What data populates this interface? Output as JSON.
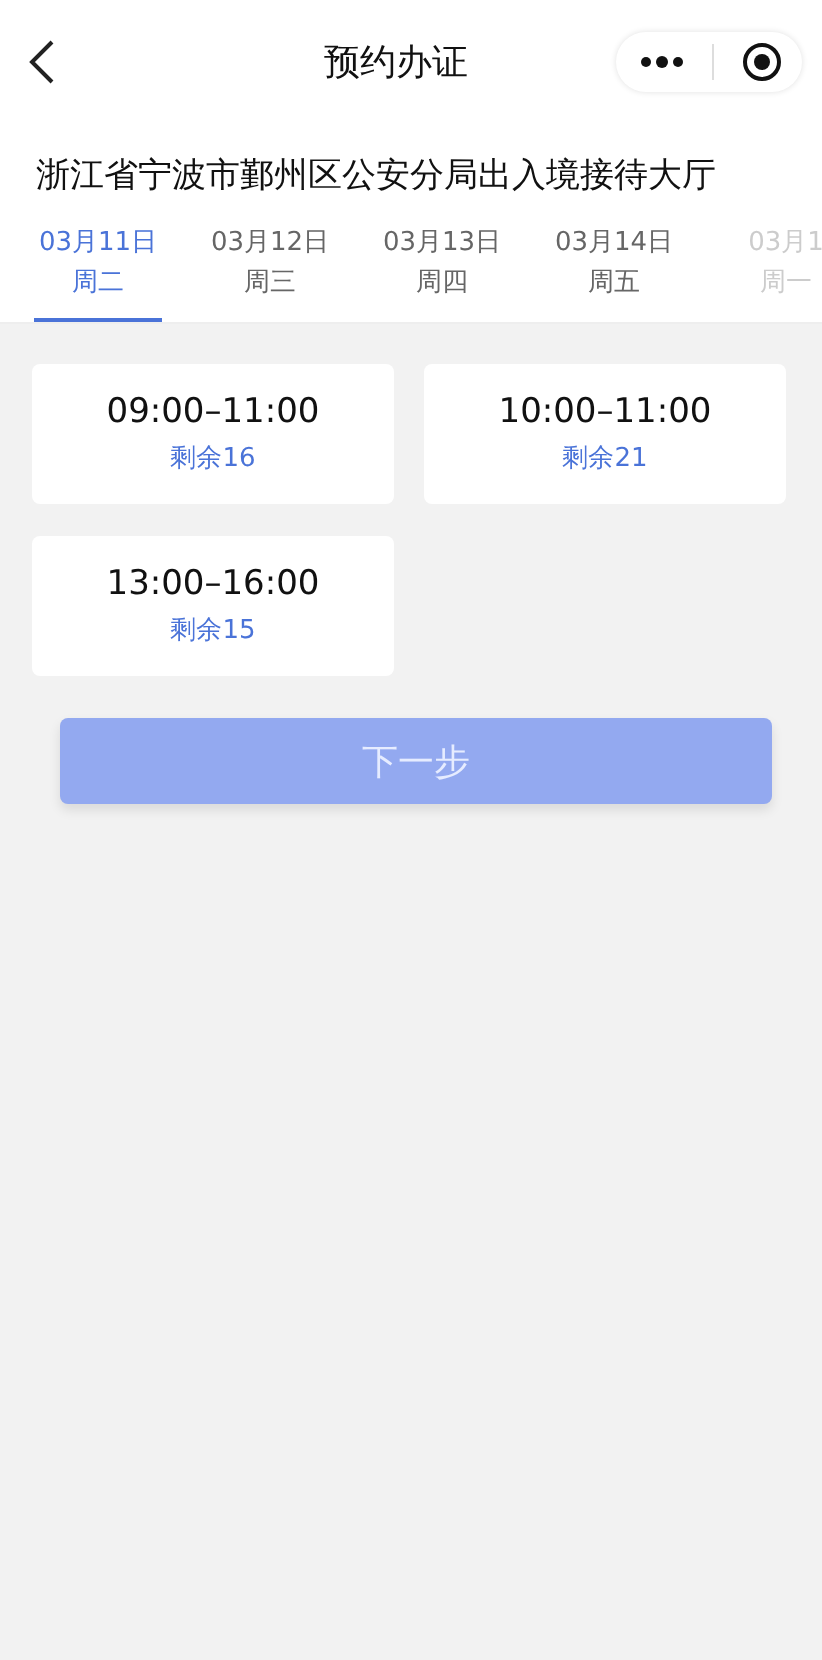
{
  "nav_bar": {
    "title": "预约办证"
  },
  "office": {
    "name": "浙江省宁波市鄞州区公安分局出入境接待大厅"
  },
  "date_tabs": [
    {
      "date": "03月11日",
      "weekday": "周二",
      "selected": true,
      "faded": false
    },
    {
      "date": "03月12日",
      "weekday": "周三",
      "selected": false,
      "faded": false
    },
    {
      "date": "03月13日",
      "weekday": "周四",
      "selected": false,
      "faded": false
    },
    {
      "date": "03月14日",
      "weekday": "周五",
      "selected": false,
      "faded": false
    },
    {
      "date": "03月1",
      "weekday": "周一",
      "selected": false,
      "faded": true
    }
  ],
  "time_slots": [
    {
      "time": "09:00–11:00",
      "remaining": "剩余16",
      "selected": false
    },
    {
      "time": "10:00–11:00",
      "remaining": "剩余21",
      "selected": false
    },
    {
      "time": "13:00–16:00",
      "remaining": "剩余15",
      "selected": false
    }
  ],
  "next_button": {
    "label": "下一步",
    "disabled": true
  }
}
